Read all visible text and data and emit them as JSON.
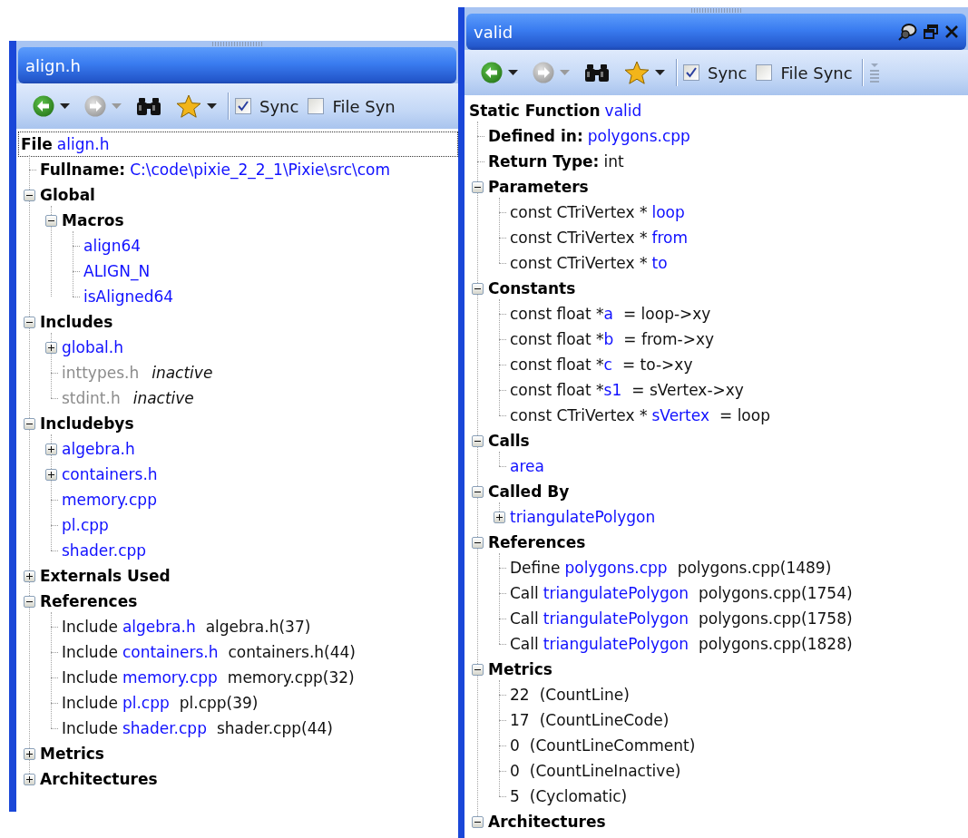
{
  "panels": [
    {
      "title": "align.h",
      "toolbar": {
        "buttons": [
          {
            "kind": "back",
            "disabled": false
          },
          {
            "kind": "forward",
            "disabled": true
          },
          {
            "kind": "find"
          },
          {
            "kind": "favorites"
          }
        ],
        "checkboxes": [
          {
            "label": "Sync",
            "checked": true
          },
          {
            "label": "File Syn",
            "checked": false
          }
        ]
      },
      "tree": {
        "focused": true,
        "parts": [
          {
            "kind": "heading",
            "text": "File"
          },
          {
            "kind": "link",
            "text": "align.h"
          }
        ],
        "children": [
          {
            "parts": [
              {
                "kind": "heading",
                "text": "Fullname:"
              },
              {
                "kind": "link",
                "text": "C:\\code\\pixie_2_2_1\\Pixie\\src\\com"
              }
            ]
          },
          {
            "expanded": true,
            "parts": [
              {
                "kind": "heading",
                "text": "Global"
              }
            ],
            "children": [
              {
                "expanded": true,
                "parts": [
                  {
                    "kind": "heading",
                    "text": "Macros"
                  }
                ],
                "children": [
                  {
                    "parts": [
                      {
                        "kind": "link",
                        "text": "align64"
                      }
                    ]
                  },
                  {
                    "parts": [
                      {
                        "kind": "link",
                        "text": "ALIGN_N"
                      }
                    ]
                  },
                  {
                    "parts": [
                      {
                        "kind": "link",
                        "text": "isAligned64"
                      }
                    ]
                  }
                ]
              }
            ]
          },
          {
            "expanded": true,
            "parts": [
              {
                "kind": "heading",
                "text": "Includes"
              }
            ],
            "children": [
              {
                "expanded": false,
                "parts": [
                  {
                    "kind": "link",
                    "text": "global.h"
                  }
                ]
              },
              {
                "parts": [
                  {
                    "kind": "inactive",
                    "text": "inttypes.h"
                  },
                  {
                    "kind": "note",
                    "text": "inactive"
                  }
                ]
              },
              {
                "parts": [
                  {
                    "kind": "inactive",
                    "text": "stdint.h"
                  },
                  {
                    "kind": "note",
                    "text": "inactive"
                  }
                ]
              }
            ]
          },
          {
            "expanded": true,
            "parts": [
              {
                "kind": "heading",
                "text": "Includebys"
              }
            ],
            "children": [
              {
                "expanded": false,
                "parts": [
                  {
                    "kind": "link",
                    "text": "algebra.h"
                  }
                ]
              },
              {
                "expanded": false,
                "parts": [
                  {
                    "kind": "link",
                    "text": "containers.h"
                  }
                ]
              },
              {
                "parts": [
                  {
                    "kind": "link",
                    "text": "memory.cpp"
                  }
                ]
              },
              {
                "parts": [
                  {
                    "kind": "link",
                    "text": "pl.cpp"
                  }
                ]
              },
              {
                "parts": [
                  {
                    "kind": "link",
                    "text": "shader.cpp"
                  }
                ]
              }
            ]
          },
          {
            "expanded": false,
            "parts": [
              {
                "kind": "heading",
                "text": "Externals Used"
              }
            ]
          },
          {
            "expanded": true,
            "parts": [
              {
                "kind": "heading",
                "text": "References"
              }
            ],
            "children": [
              {
                "parts": [
                  {
                    "kind": "text",
                    "text": "Include"
                  },
                  {
                    "kind": "link",
                    "text": "algebra.h"
                  },
                  {
                    "kind": "location",
                    "text": "algebra.h(37)"
                  }
                ]
              },
              {
                "parts": [
                  {
                    "kind": "text",
                    "text": "Include"
                  },
                  {
                    "kind": "link",
                    "text": "containers.h"
                  },
                  {
                    "kind": "location",
                    "text": "containers.h(44)"
                  }
                ]
              },
              {
                "parts": [
                  {
                    "kind": "text",
                    "text": "Include"
                  },
                  {
                    "kind": "link",
                    "text": "memory.cpp"
                  },
                  {
                    "kind": "location",
                    "text": "memory.cpp(32)"
                  }
                ]
              },
              {
                "parts": [
                  {
                    "kind": "text",
                    "text": "Include"
                  },
                  {
                    "kind": "link",
                    "text": "pl.cpp"
                  },
                  {
                    "kind": "location",
                    "text": "pl.cpp(39)"
                  }
                ]
              },
              {
                "parts": [
                  {
                    "kind": "text",
                    "text": "Include"
                  },
                  {
                    "kind": "link",
                    "text": "shader.cpp"
                  },
                  {
                    "kind": "location",
                    "text": "shader.cpp(44)"
                  }
                ]
              }
            ]
          },
          {
            "expanded": false,
            "parts": [
              {
                "kind": "heading",
                "text": "Metrics"
              }
            ]
          },
          {
            "expanded": false,
            "parts": [
              {
                "kind": "heading",
                "text": "Architectures"
              }
            ]
          }
        ]
      }
    },
    {
      "title": "valid",
      "title_buttons": [
        {
          "kind": "pin"
        },
        {
          "kind": "restore"
        },
        {
          "kind": "close"
        }
      ],
      "toolbar": {
        "buttons": [
          {
            "kind": "back",
            "disabled": false
          },
          {
            "kind": "forward",
            "disabled": true
          },
          {
            "kind": "find"
          },
          {
            "kind": "favorites"
          }
        ],
        "checkboxes": [
          {
            "label": "Sync",
            "checked": true
          },
          {
            "label": "File Sync",
            "checked": false
          }
        ],
        "overflow": true
      },
      "tree": {
        "focused": false,
        "parts": [
          {
            "kind": "heading",
            "text": "Static Function"
          },
          {
            "kind": "link",
            "text": "valid"
          }
        ],
        "children": [
          {
            "parts": [
              {
                "kind": "heading",
                "text": "Defined in:"
              },
              {
                "kind": "link",
                "text": "polygons.cpp"
              }
            ]
          },
          {
            "parts": [
              {
                "kind": "heading",
                "text": "Return Type:"
              },
              {
                "kind": "text",
                "text": "int"
              }
            ]
          },
          {
            "expanded": true,
            "parts": [
              {
                "kind": "heading",
                "text": "Parameters"
              }
            ],
            "children": [
              {
                "parts": [
                  {
                    "kind": "text",
                    "text": "const CTriVertex *"
                  },
                  {
                    "kind": "link",
                    "text": "loop"
                  }
                ]
              },
              {
                "parts": [
                  {
                    "kind": "text",
                    "text": "const CTriVertex *"
                  },
                  {
                    "kind": "link",
                    "text": "from"
                  }
                ]
              },
              {
                "parts": [
                  {
                    "kind": "text",
                    "text": "const CTriVertex *"
                  },
                  {
                    "kind": "link",
                    "text": "to"
                  }
                ]
              }
            ]
          },
          {
            "expanded": true,
            "parts": [
              {
                "kind": "heading",
                "text": "Constants"
              }
            ],
            "children": [
              {
                "parts": [
                  {
                    "kind": "text",
                    "text": "const float *"
                  },
                  {
                    "kind": "link",
                    "text": "a",
                    "tight": true
                  },
                  {
                    "kind": "value",
                    "text": "= loop->xy"
                  }
                ]
              },
              {
                "parts": [
                  {
                    "kind": "text",
                    "text": "const float *"
                  },
                  {
                    "kind": "link",
                    "text": "b",
                    "tight": true
                  },
                  {
                    "kind": "value",
                    "text": "= from->xy"
                  }
                ]
              },
              {
                "parts": [
                  {
                    "kind": "text",
                    "text": "const float *"
                  },
                  {
                    "kind": "link",
                    "text": "c",
                    "tight": true
                  },
                  {
                    "kind": "value",
                    "text": "= to->xy"
                  }
                ]
              },
              {
                "parts": [
                  {
                    "kind": "text",
                    "text": "const float *"
                  },
                  {
                    "kind": "link",
                    "text": "s1",
                    "tight": true
                  },
                  {
                    "kind": "value",
                    "text": "= sVertex->xy"
                  }
                ]
              },
              {
                "parts": [
                  {
                    "kind": "text",
                    "text": "const CTriVertex *"
                  },
                  {
                    "kind": "link",
                    "text": "sVertex"
                  },
                  {
                    "kind": "value",
                    "text": "= loop"
                  }
                ]
              }
            ]
          },
          {
            "expanded": true,
            "parts": [
              {
                "kind": "heading",
                "text": "Calls"
              }
            ],
            "children": [
              {
                "parts": [
                  {
                    "kind": "link",
                    "text": "area"
                  }
                ]
              }
            ]
          },
          {
            "expanded": true,
            "parts": [
              {
                "kind": "heading",
                "text": "Called By"
              }
            ],
            "children": [
              {
                "expanded": false,
                "parts": [
                  {
                    "kind": "link",
                    "text": "triangulatePolygon"
                  }
                ]
              }
            ]
          },
          {
            "expanded": true,
            "parts": [
              {
                "kind": "heading",
                "text": "References"
              }
            ],
            "children": [
              {
                "parts": [
                  {
                    "kind": "text",
                    "text": "Define"
                  },
                  {
                    "kind": "link",
                    "text": "polygons.cpp"
                  },
                  {
                    "kind": "location",
                    "text": "polygons.cpp(1489)"
                  }
                ]
              },
              {
                "parts": [
                  {
                    "kind": "text",
                    "text": "Call"
                  },
                  {
                    "kind": "link",
                    "text": "triangulatePolygon"
                  },
                  {
                    "kind": "location",
                    "text": "polygons.cpp(1754)"
                  }
                ]
              },
              {
                "parts": [
                  {
                    "kind": "text",
                    "text": "Call"
                  },
                  {
                    "kind": "link",
                    "text": "triangulatePolygon"
                  },
                  {
                    "kind": "location",
                    "text": "polygons.cpp(1758)"
                  }
                ]
              },
              {
                "parts": [
                  {
                    "kind": "text",
                    "text": "Call"
                  },
                  {
                    "kind": "link",
                    "text": "triangulatePolygon"
                  },
                  {
                    "kind": "location",
                    "text": "polygons.cpp(1828)"
                  }
                ]
              }
            ]
          },
          {
            "expanded": true,
            "parts": [
              {
                "kind": "heading",
                "text": "Metrics"
              }
            ],
            "children": [
              {
                "parts": [
                  {
                    "kind": "text",
                    "text": "22"
                  },
                  {
                    "kind": "value",
                    "text": "(CountLine)"
                  }
                ]
              },
              {
                "parts": [
                  {
                    "kind": "text",
                    "text": "17"
                  },
                  {
                    "kind": "value",
                    "text": "(CountLineCode)"
                  }
                ]
              },
              {
                "parts": [
                  {
                    "kind": "text",
                    "text": "0"
                  },
                  {
                    "kind": "value",
                    "text": "(CountLineComment)"
                  }
                ]
              },
              {
                "parts": [
                  {
                    "kind": "text",
                    "text": "0"
                  },
                  {
                    "kind": "value",
                    "text": "(CountLineInactive)"
                  }
                ]
              },
              {
                "parts": [
                  {
                    "kind": "text",
                    "text": "5"
                  },
                  {
                    "kind": "value",
                    "text": "(Cyclomatic)"
                  }
                ]
              }
            ]
          },
          {
            "expanded": true,
            "parts": [
              {
                "kind": "heading",
                "text": "Architectures"
              }
            ]
          }
        ]
      }
    }
  ]
}
